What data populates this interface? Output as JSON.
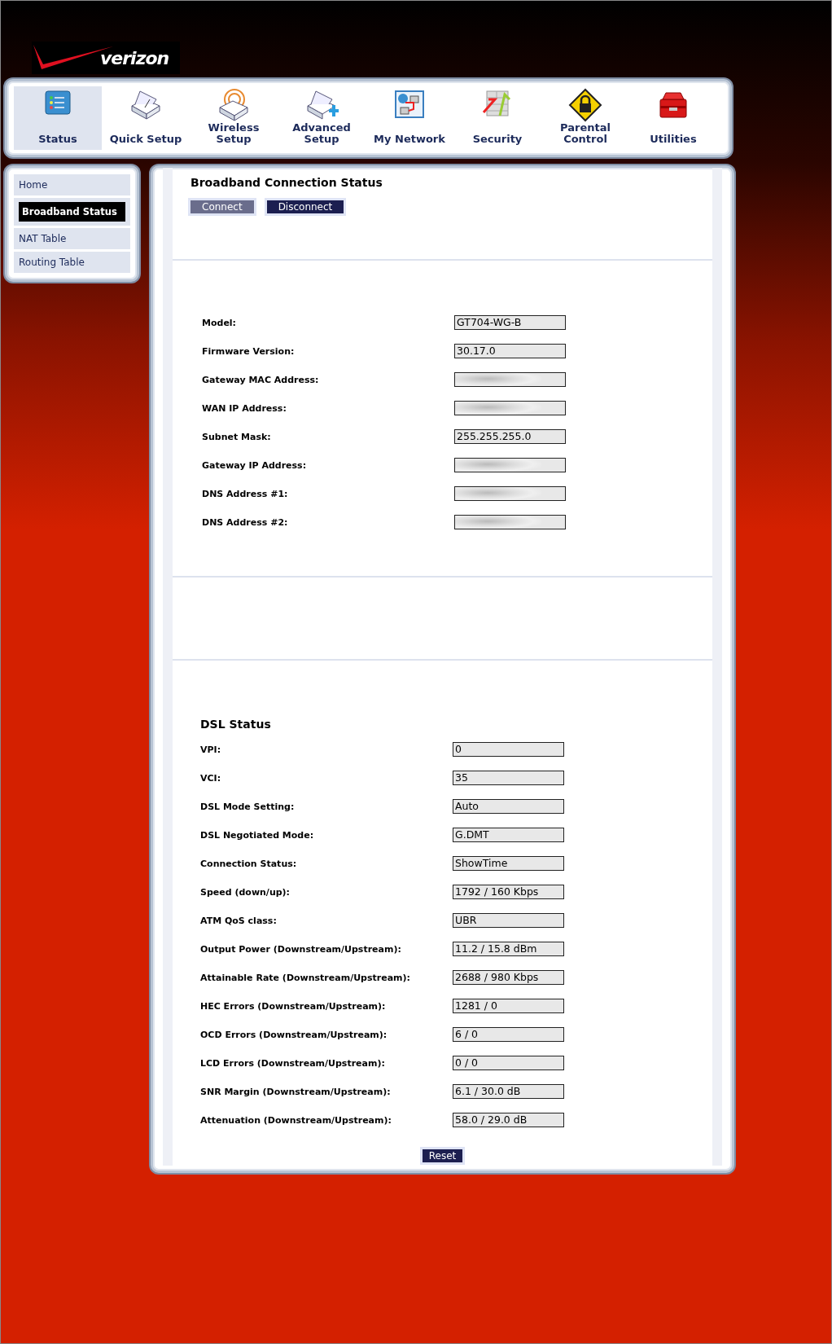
{
  "logo": {
    "text": "verizon"
  },
  "nav": [
    {
      "label": "Status",
      "selected": true
    },
    {
      "label": "Quick Setup",
      "selected": false
    },
    {
      "label": "Wireless Setup",
      "selected": false
    },
    {
      "label": "Advanced Setup",
      "selected": false
    },
    {
      "label": "My Network",
      "selected": false
    },
    {
      "label": "Security",
      "selected": false
    },
    {
      "label": "Parental Control",
      "selected": false
    },
    {
      "label": "Utilities",
      "selected": false
    }
  ],
  "sidebar": {
    "items": [
      {
        "label": "Home",
        "selected": false
      },
      {
        "label": "Broadband Status",
        "selected": true
      },
      {
        "label": "NAT Table",
        "selected": false
      },
      {
        "label": "Routing Table",
        "selected": false
      }
    ]
  },
  "connection": {
    "title": "Broadband Connection Status",
    "buttons": [
      "Connect",
      "Disconnect"
    ],
    "rows": [
      {
        "label": "Model:",
        "value": "GT704-WG-B",
        "redacted": false
      },
      {
        "label": "Firmware Version:",
        "value": "30.17.0",
        "redacted": false
      },
      {
        "label": "Gateway MAC Address:",
        "redacted": true
      },
      {
        "label": "WAN IP Address:",
        "redacted": true
      },
      {
        "label": "Subnet Mask:",
        "value": "255.255.255.0",
        "redacted": false
      },
      {
        "label": "Gateway IP Address:",
        "redacted": true
      },
      {
        "label": "DNS Address #1:",
        "redacted": true
      },
      {
        "label": "DNS Address #2:",
        "redacted": true
      }
    ]
  },
  "dsl": {
    "title": "DSL Status",
    "rows": [
      {
        "label": "VPI:",
        "value": "0"
      },
      {
        "label": "VCI:",
        "value": "35"
      },
      {
        "label": "DSL Mode Setting:",
        "value": "Auto"
      },
      {
        "label": "DSL Negotiated Mode:",
        "value": "G.DMT"
      },
      {
        "label": "Connection Status:",
        "value": "ShowTime"
      },
      {
        "label": "Speed (down/up):",
        "value": "1792 / 160 Kbps"
      },
      {
        "label": "ATM QoS class:",
        "value": "UBR"
      },
      {
        "label": "Output Power (Downstream/Upstream):",
        "value": "11.2 / 15.8 dBm"
      },
      {
        "label": "Attainable Rate (Downstream/Upstream):",
        "value": "2688 / 980 Kbps"
      },
      {
        "label": "HEC Errors (Downstream/Upstream):",
        "value": "1281 / 0"
      },
      {
        "label": "OCD Errors (Downstream/Upstream):",
        "value": "6 / 0"
      },
      {
        "label": "LCD Errors (Downstream/Upstream):",
        "value": "0 / 0"
      },
      {
        "label": "SNR Margin (Downstream/Upstream):",
        "value": "6.1 / 30.0 dB"
      },
      {
        "label": "Attenuation (Downstream/Upstream):",
        "value": "58.0 / 29.0 dB"
      }
    ],
    "button": "Reset"
  }
}
